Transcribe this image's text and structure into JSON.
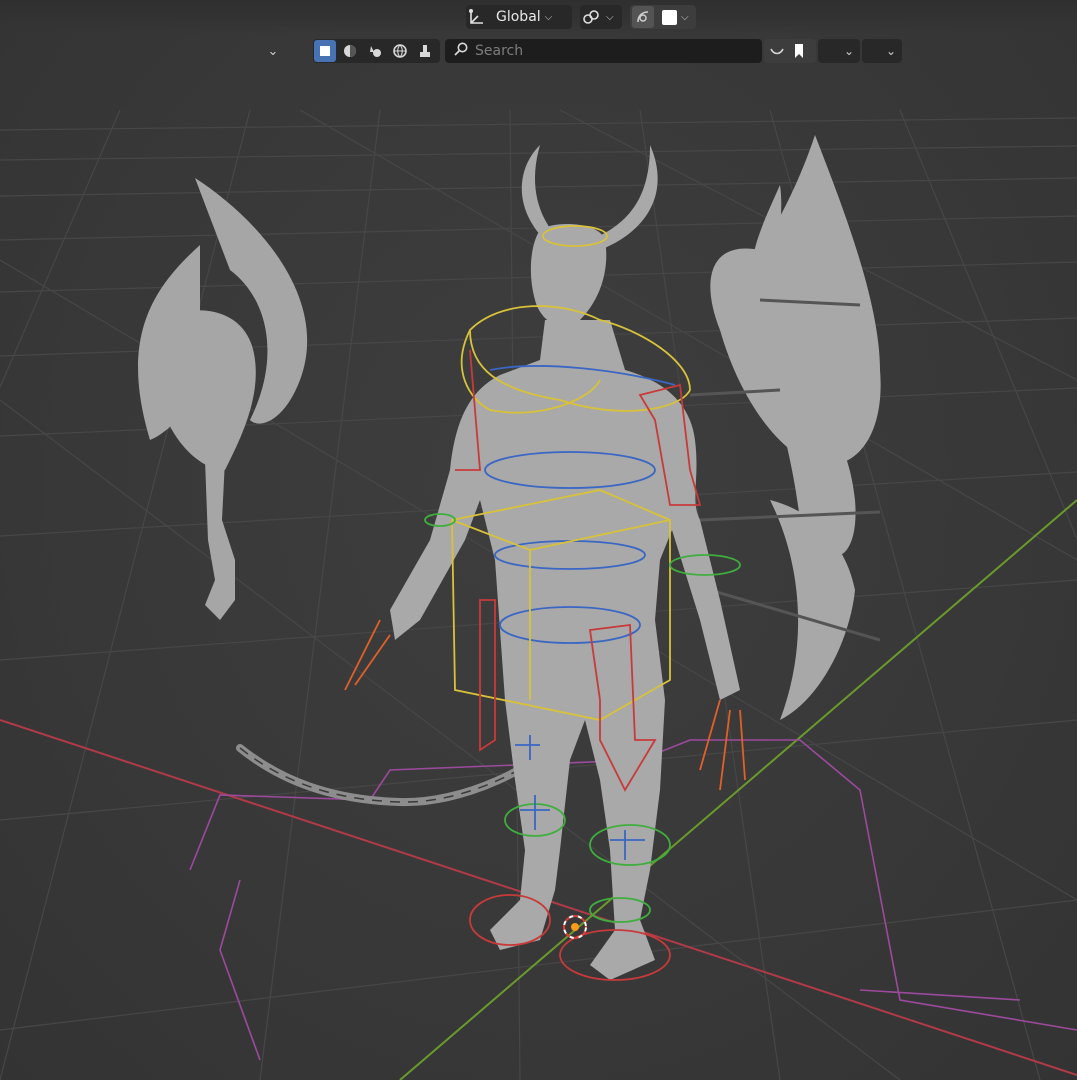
{
  "header": {
    "transform_orientation": {
      "label": "Global",
      "icon": "transform-orientation-icon"
    },
    "snapping": {
      "icon": "link-icon"
    },
    "proportional": {
      "icon": "proportional-edit-icon"
    },
    "color_swatch": "#ffffff"
  },
  "toolbar": {
    "collapse_icon": "chevron-down-icon",
    "filter_icons": [
      "object-select-icon",
      "shading-icon",
      "physics-icon",
      "world-icon",
      "brush-icon"
    ],
    "search": {
      "placeholder": "Search",
      "value": ""
    },
    "bookmark_icon": "bookmark-icon"
  },
  "viewport": {
    "background": "#393939",
    "grid_color": "#474747",
    "x_axis_color": "#b03a48",
    "y_axis_color": "#6a9a2c",
    "rig_colors": {
      "torso": "#d8c23a",
      "spine": "#3a66c4",
      "ik": "#3fae3f",
      "fk": "#c83a3a",
      "root": "#9c4a9c"
    }
  }
}
